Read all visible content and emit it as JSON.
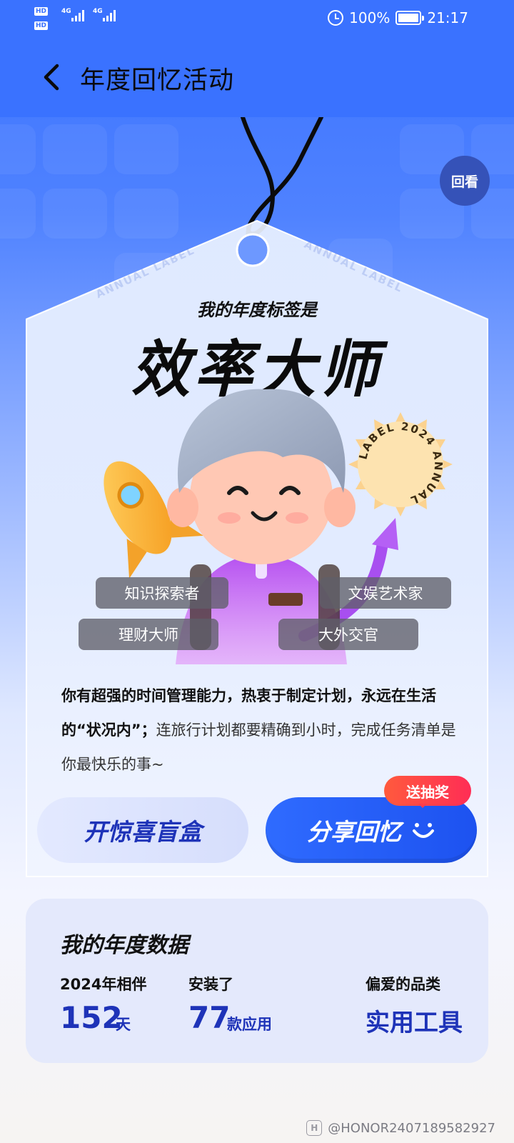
{
  "status_bar": {
    "hd1": "HD",
    "hd2": "HD",
    "net1": "4G",
    "net2": "4G",
    "battery": "100%",
    "time": "21:17"
  },
  "app_bar": {
    "title": "年度回忆活动"
  },
  "replay_label": "回看",
  "tag": {
    "watermark_text": "ANNUAL LABEL",
    "intro": "我的年度标签是",
    "title": "效率大师",
    "badge_text": "LABEL 2024 ANNUAL"
  },
  "chips": [
    "知识探索者",
    "文娱艺术家",
    "理财大师",
    "大外交官"
  ],
  "description": {
    "bold": "你有超强的时间管理能力，热衷于制定计划，永远在生活的“状况内”；",
    "plain": "连旅行计划都要精确到小时，完成任务清单是你最快乐的事~"
  },
  "buttons": {
    "blind_box": "开惊喜盲盒",
    "share": "分享回忆",
    "lottery_badge": "送抽奖"
  },
  "stats": {
    "title": "我的年度数据",
    "companion_label": "2024年相伴",
    "companion_value": "152",
    "companion_unit": "天",
    "installed_label": "安装了",
    "installed_value": "77",
    "installed_unit": "款应用",
    "favorite_label": "偏爱的品类",
    "favorite_value": "实用工具"
  },
  "watermark": "@HONOR2407189582927",
  "colors": {
    "primary_blue": "#3a72ff",
    "accent_navy": "#1e33b8",
    "badge_red": "#ff3d4c"
  }
}
